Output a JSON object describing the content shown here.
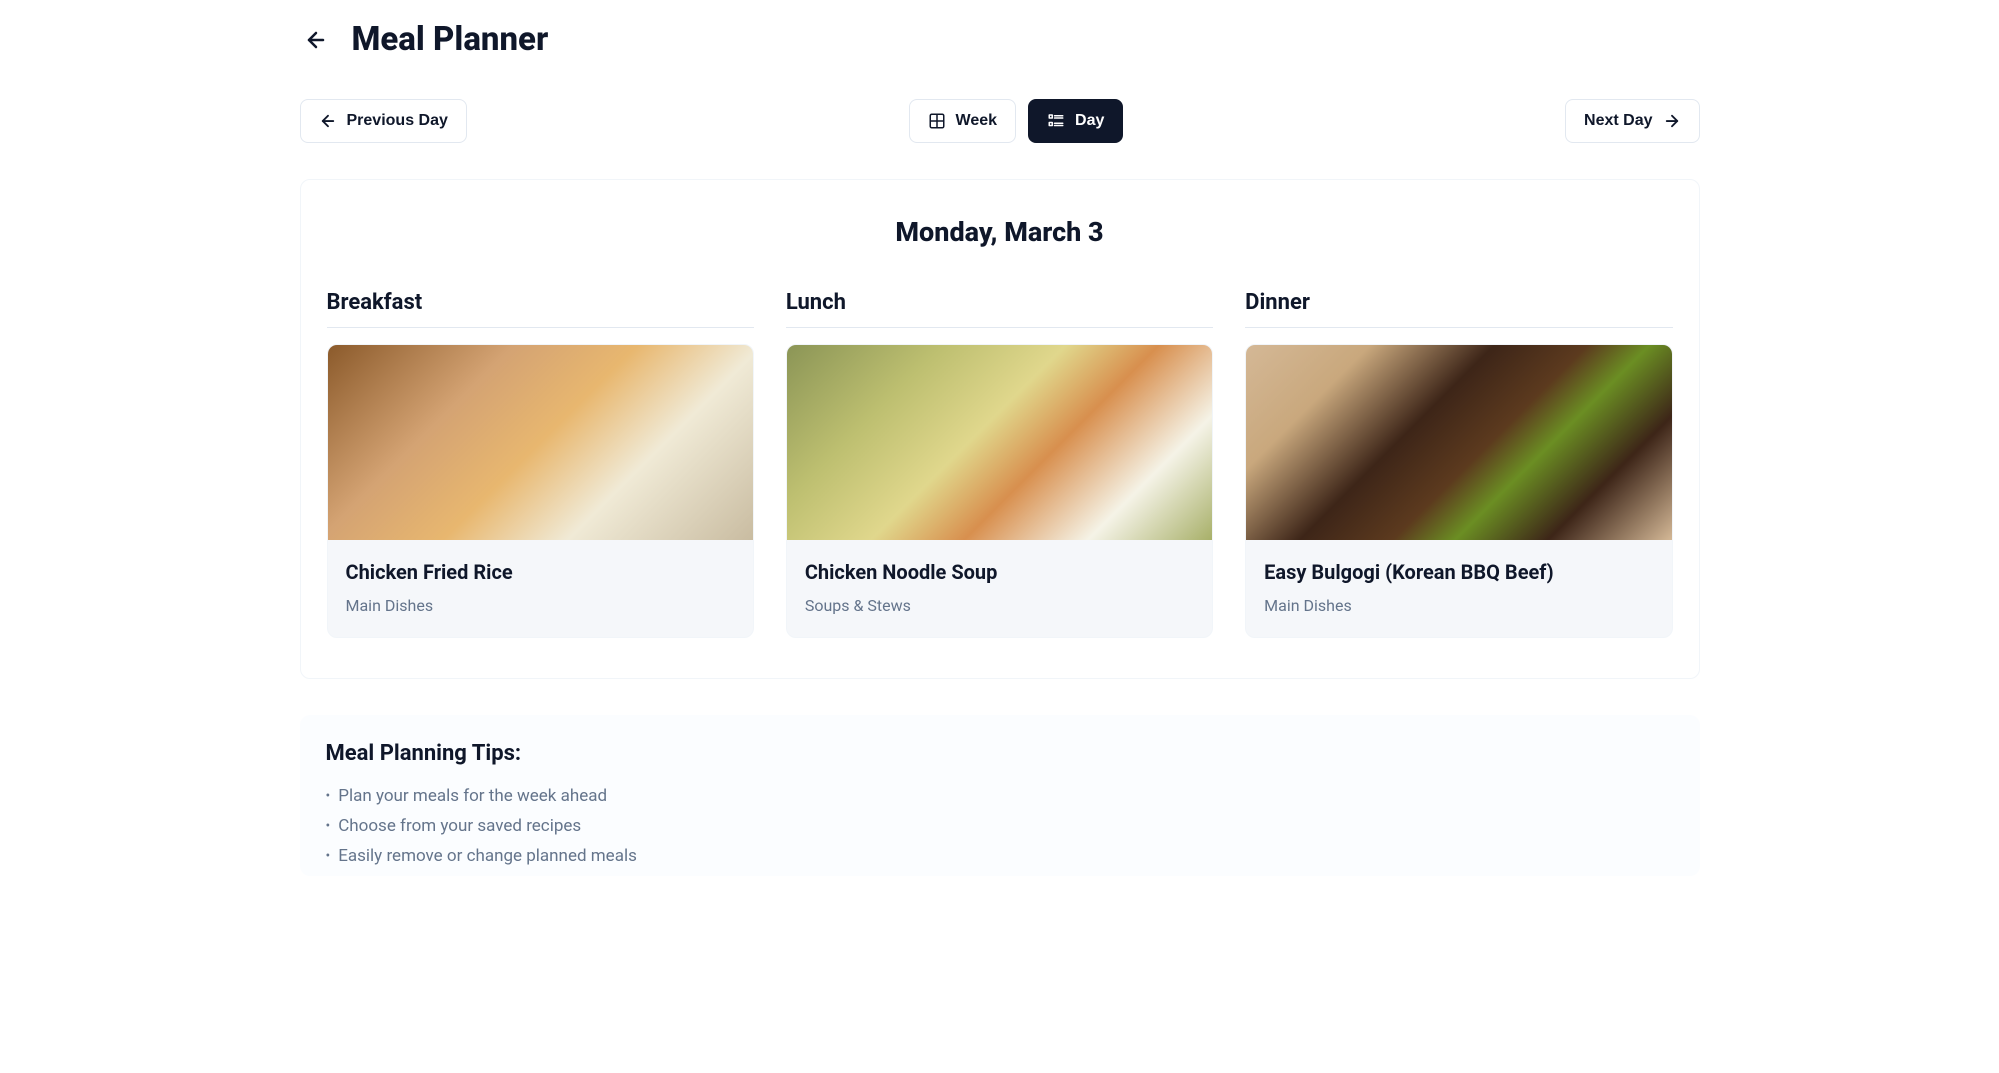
{
  "header": {
    "title": "Meal Planner"
  },
  "nav": {
    "prev_label": "Previous Day",
    "next_label": "Next Day",
    "week_label": "Week",
    "day_label": "Day",
    "active_view": "day"
  },
  "day": {
    "date": "Monday, March 3",
    "meals": [
      {
        "slot": "Breakfast",
        "name": "Chicken Fried Rice",
        "category": "Main Dishes"
      },
      {
        "slot": "Lunch",
        "name": "Chicken Noodle Soup",
        "category": "Soups & Stews"
      },
      {
        "slot": "Dinner",
        "name": "Easy Bulgogi (Korean BBQ Beef)",
        "category": "Main Dishes"
      }
    ]
  },
  "tips": {
    "title": "Meal Planning Tips:",
    "items": [
      "Plan your meals for the week ahead",
      "Choose from your saved recipes",
      "Easily remove or change planned meals"
    ]
  }
}
